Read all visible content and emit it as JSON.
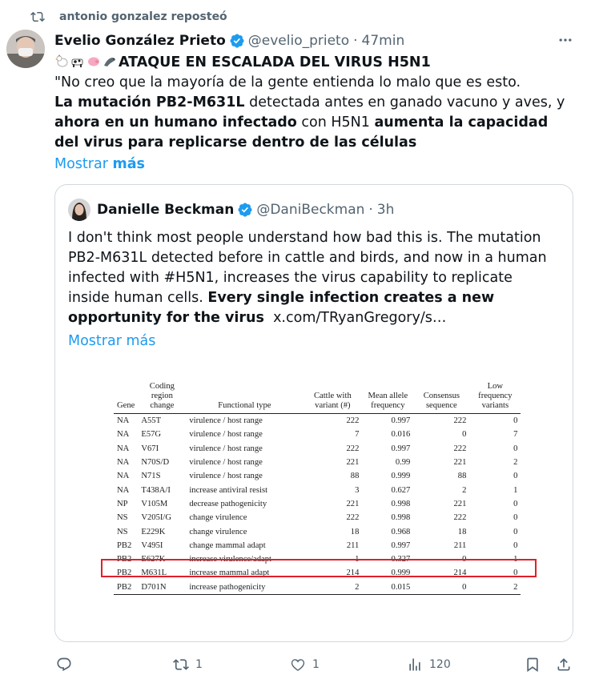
{
  "repost": {
    "text": "antonio gonzalez reposteó"
  },
  "post": {
    "author_name": "Evelio González Prieto",
    "handle": "@evelio_prieto",
    "separator": "·",
    "time": "47min",
    "headline": "ATAQUE EN ESCALADA DEL VIRUS H5N1",
    "line1": "\"No creo que la mayoría de la gente entienda lo malo que es esto.",
    "seg1_bold": "La mutación PB2-M631L",
    "seg2": " detectada antes en ganado vacuno y aves, y ",
    "seg3_bold": "ahora en un humano infectado",
    "seg4": " con H5N1 ",
    "seg5_bold": "aumenta la capacidad del virus para replicarse dentro de las células",
    "show_more_1": "Mostrar",
    "show_more_2": "más",
    "emojis": [
      "chicken-emoji",
      "cow-emoji",
      "pig-emoji",
      "seal-emoji"
    ]
  },
  "quote": {
    "author_name": "Danielle Beckman",
    "handle": "@DaniBeckman",
    "separator": "·",
    "time": "3h",
    "text": "I don't think most people understand how bad this is. The mutation PB2-M631L detected before in cattle and birds, and now in a human infected with #H5N1, increases the virus capability to replicate inside human cells.",
    "bold_text": "Every single infection creates a new opportunity for the virus",
    "link": "x.com/TRyanGregory/s…",
    "show_more": "Mostrar más"
  },
  "table": {
    "headers": [
      "Gene",
      "Coding region change",
      "Functional type",
      "Cattle with variant (#)",
      "Mean allele frequency",
      "Consensus sequence",
      "Low frequency variants"
    ],
    "rows": [
      [
        "NA",
        "A55T",
        "virulence / host range",
        "222",
        "0.997",
        "222",
        "0"
      ],
      [
        "NA",
        "E57G",
        "virulence / host range",
        "7",
        "0.016",
        "0",
        "7"
      ],
      [
        "NA",
        "V67I",
        "virulence / host range",
        "222",
        "0.997",
        "222",
        "0"
      ],
      [
        "NA",
        "N70S/D",
        "virulence / host range",
        "221",
        "0.99",
        "221",
        "2"
      ],
      [
        "NA",
        "N71S",
        "virulence / host range",
        "88",
        "0.999",
        "88",
        "0"
      ],
      [
        "NA",
        "T438A/I",
        "increase antiviral resist",
        "3",
        "0.627",
        "2",
        "1"
      ],
      [
        "NP",
        "V105M",
        "decrease pathogenicity",
        "221",
        "0.998",
        "221",
        "0"
      ],
      [
        "NS",
        "V205I/G",
        "change virulence",
        "222",
        "0.998",
        "222",
        "0"
      ],
      [
        "NS",
        "E229K",
        "change virulence",
        "18",
        "0.968",
        "18",
        "0"
      ],
      [
        "PB2",
        "V495I",
        "change mammal adapt",
        "211",
        "0.997",
        "211",
        "0"
      ],
      [
        "PB2",
        "E627K",
        "increase virulence/adapt",
        "1",
        "0.327",
        "0",
        "1"
      ],
      [
        "PB2",
        "M631L",
        "increase mammal adapt",
        "214",
        "0.999",
        "214",
        "0"
      ],
      [
        "PB2",
        "D701N",
        "increase pathogenicity",
        "2",
        "0.015",
        "0",
        "2"
      ]
    ],
    "highlighted_row": "M631L"
  },
  "actions": {
    "reply": "",
    "repost": "1",
    "like": "1",
    "views": "120"
  },
  "colors": {
    "link": "#1d9bf0",
    "muted": "#536471",
    "verified": "#1d9bf0",
    "highlight": "#e0202a"
  }
}
